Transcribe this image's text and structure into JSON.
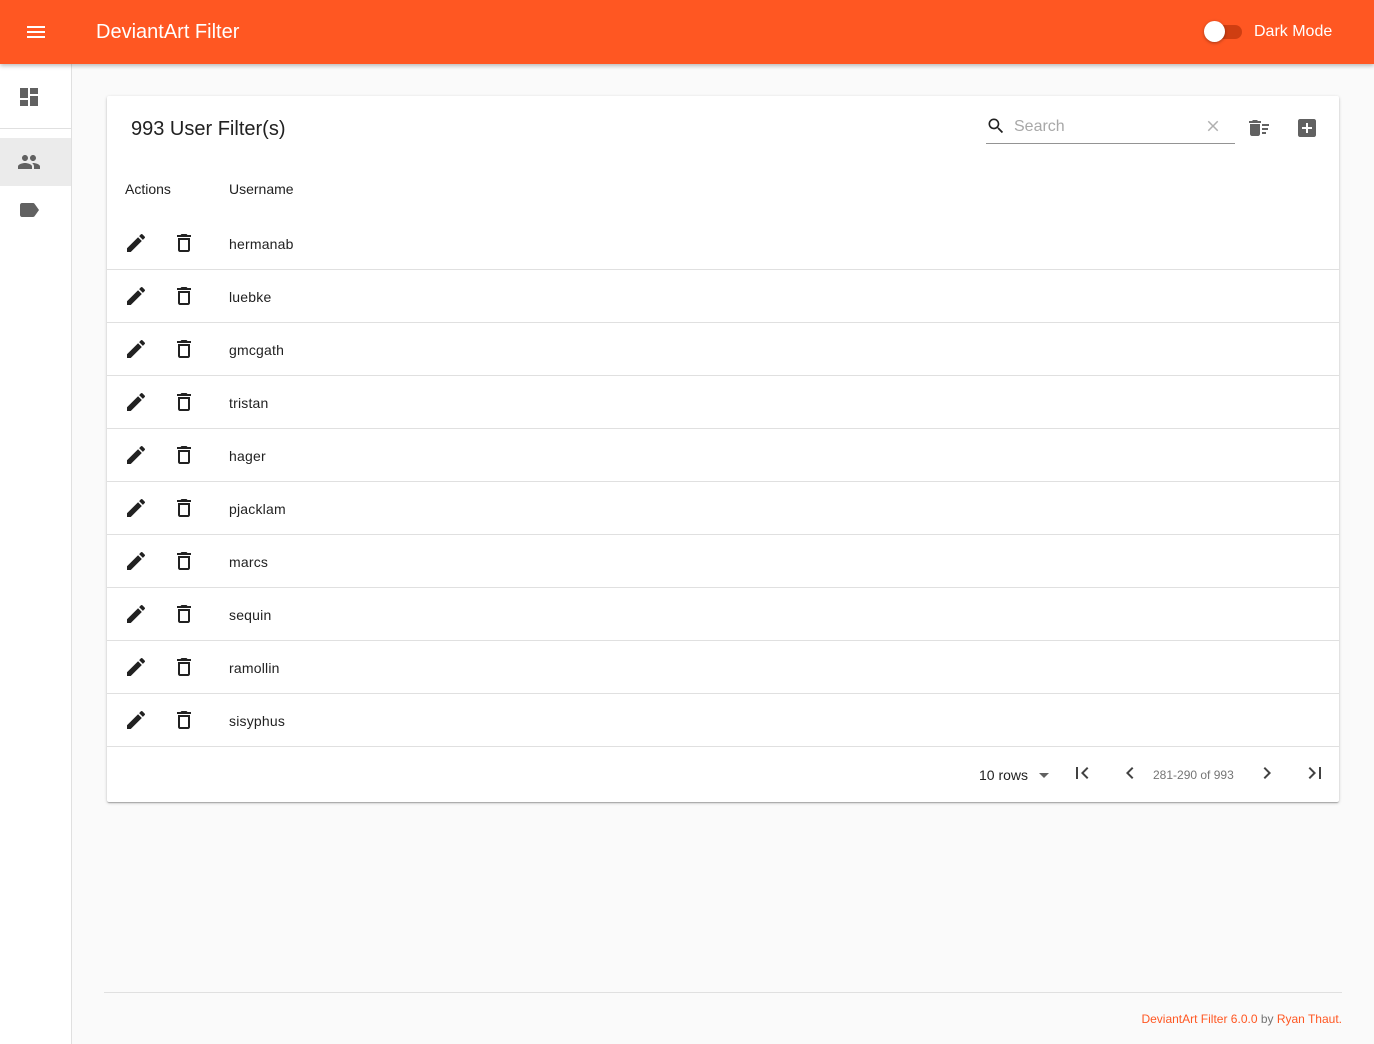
{
  "app": {
    "title": "DeviantArt Filter",
    "dark_mode_label": "Dark Mode",
    "dark_mode_enabled": false,
    "accent_color": "#ff5722"
  },
  "nav": {
    "items": [
      {
        "icon": "dashboard-icon",
        "active": false
      },
      {
        "icon": "people-icon",
        "active": true
      },
      {
        "icon": "label-icon",
        "active": false
      }
    ]
  },
  "card": {
    "title": "993 User Filter(s)",
    "search_placeholder": "Search",
    "search_value": "",
    "columns": {
      "actions": "Actions",
      "username": "Username"
    },
    "rows": [
      {
        "username": "hermanab"
      },
      {
        "username": "luebke"
      },
      {
        "username": "gmcgath"
      },
      {
        "username": "tristan"
      },
      {
        "username": "hager"
      },
      {
        "username": "pjacklam"
      },
      {
        "username": "marcs"
      },
      {
        "username": "sequin"
      },
      {
        "username": "ramollin"
      },
      {
        "username": "sisyphus"
      }
    ]
  },
  "pagination": {
    "rows_label": "10 rows",
    "range_label": "281-290 of 993"
  },
  "footer": {
    "app_link": "DeviantArt Filter 6.0.0",
    "by_text": " by ",
    "author_link": "Ryan Thaut."
  }
}
